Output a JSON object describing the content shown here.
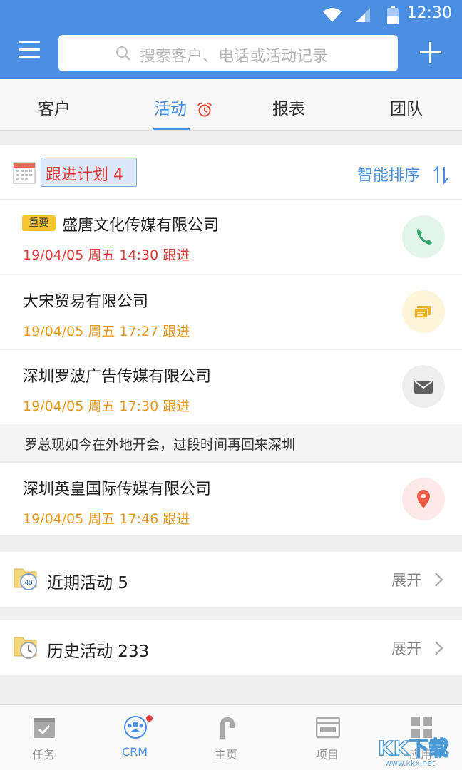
{
  "status_bar": {
    "time": "12:30"
  },
  "search": {
    "placeholder": "搜索客户、电话或活动记录"
  },
  "tabs": [
    {
      "label": "客户"
    },
    {
      "label": "活动"
    },
    {
      "label": "报表"
    },
    {
      "label": "团队"
    }
  ],
  "plan": {
    "title": "跟进计划 4",
    "sort_label": "智能排序"
  },
  "activities": [
    {
      "tag": "重要",
      "company": "盛唐文化传媒有限公司",
      "time": "19/04/05 周五 14:30 跟进",
      "time_color": "#e03a3a",
      "action_icon": "phone-icon"
    },
    {
      "company": "大宋贸易有限公司",
      "time": "19/04/05 周五 17:27 跟进",
      "time_color": "#e79a1c",
      "action_icon": "message-icon"
    },
    {
      "company": "深圳罗波广告传媒有限公司",
      "time": "19/04/05 周五 17:30 跟进",
      "time_color": "#e79a1c",
      "action_icon": "mail-icon",
      "note": "罗总现如今在外地开会，过段时间再回来深圳"
    },
    {
      "company": "深圳英皇国际传媒有限公司",
      "time": "19/04/05 周五 17:46 跟进",
      "time_color": "#e79a1c",
      "action_icon": "location-icon"
    }
  ],
  "sections": [
    {
      "title": "近期活动 5",
      "expand": "展开",
      "icon_label": "48"
    },
    {
      "title": "历史活动 233",
      "expand": "展开"
    }
  ],
  "bottom_nav": [
    {
      "label": "任务"
    },
    {
      "label": "CRM"
    },
    {
      "label": "主页"
    },
    {
      "label": "项目"
    },
    {
      "label": "应用"
    }
  ],
  "watermark": {
    "text": "KK下载",
    "url": "www.kkx.net"
  },
  "colors": {
    "brand": "#4a8fe2",
    "urgent": "#e03a3a",
    "pending": "#e79a1c"
  }
}
